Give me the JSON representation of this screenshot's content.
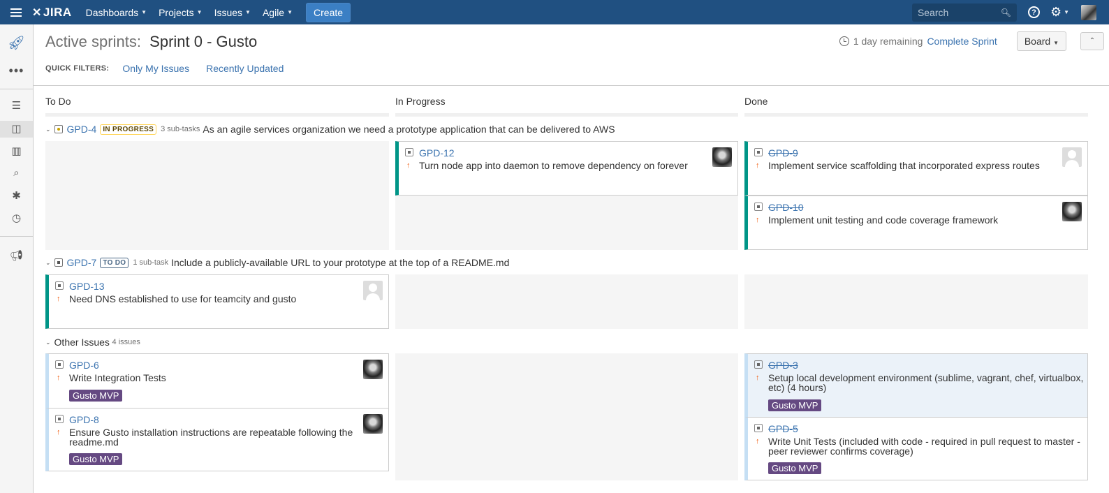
{
  "nav": {
    "logo": "JIRA",
    "items": [
      "Dashboards",
      "Projects",
      "Issues",
      "Agile"
    ],
    "create": "Create",
    "search_placeholder": "Search"
  },
  "header": {
    "title_label": "Active sprints:",
    "sprint_name": "Sprint 0 - Gusto",
    "remaining": "1 day remaining",
    "complete": "Complete Sprint",
    "board": "Board",
    "quick_filters_label": "QUICK FILTERS:",
    "quick_filters": [
      "Only My Issues",
      "Recently Updated"
    ]
  },
  "columns": [
    "To Do",
    "In Progress",
    "Done"
  ],
  "lanes": [
    {
      "key": "GPD-4",
      "status": "IN PROGRESS",
      "subtasks": "3 sub-tasks",
      "summary": "As an agile services organization we need a prototype application that can be delivered to AWS"
    },
    {
      "key": "GPD-7",
      "status": "TO DO",
      "subtasks": "1 sub-task",
      "summary": "Include a publicly-available URL to your prototype at the top of a README.md"
    },
    {
      "title": "Other Issues",
      "count": "4 issues"
    }
  ],
  "cards": [
    {
      "key": "GPD-12",
      "summary": "Turn node app into daemon to remove dependency on forever"
    },
    {
      "key": "GPD-9",
      "summary": "Implement service scaffolding that incorporated express routes"
    },
    {
      "key": "GPD-10",
      "summary": "Implement unit testing and code coverage framework"
    },
    {
      "key": "GPD-13",
      "summary": "Need DNS established to use for teamcity and gusto"
    },
    {
      "key": "GPD-6",
      "summary": "Write Integration Tests",
      "epic": "Gusto MVP"
    },
    {
      "key": "GPD-8",
      "summary1": "Ensure Gusto installation instructions are repeatable following the",
      "summary2": "readme.md",
      "epic": "Gusto MVP"
    },
    {
      "key": "GPD-3",
      "summary1": "Setup local development environment (sublime, vagrant, chef, virtualbox,",
      "summary2": "etc) (4 hours)",
      "epic": "Gusto MVP"
    },
    {
      "key": "GPD-5",
      "summary1": "Write Unit Tests (included with code - required in pull request to master -",
      "summary2": "peer reviewer confirms coverage)",
      "epic": "Gusto MVP"
    }
  ],
  "colors": {
    "nav": "#205081",
    "done_bar": "#009587",
    "epic": "#654982",
    "link": "#3b73af"
  }
}
